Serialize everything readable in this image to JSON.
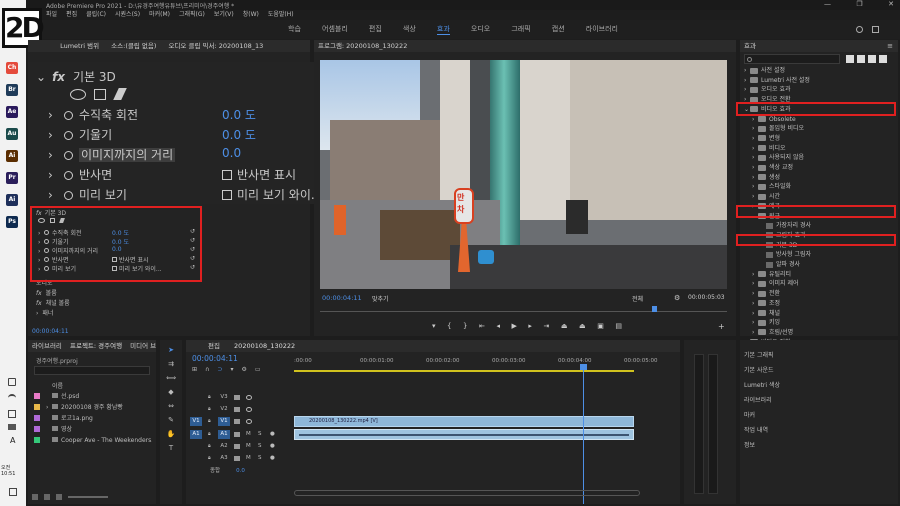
{
  "window": {
    "title": "Adobe Premiere Pro 2021 - D:\\유경주여행유튜브\\프리미어\\경주여행 *",
    "menu": [
      "파일",
      "편집",
      "클립(C)",
      "시퀀스(S)",
      "마커(M)",
      "그래픽(G)",
      "보기(V)",
      "창(W)",
      "도움말(H)"
    ],
    "controls": [
      "—",
      "❐",
      "✕"
    ]
  },
  "logo_text": "2D",
  "workspaces": [
    "학습",
    "어셈블리",
    "편집",
    "색상",
    "효과",
    "오디오",
    "그래픽",
    "캡션",
    "라이브러리"
  ],
  "active_workspace": "효과",
  "taskbar_icons": [
    {
      "label": "Ch",
      "color": "#e44b3c"
    },
    {
      "label": "Br",
      "color": "#1f3b59"
    },
    {
      "label": "Ae",
      "color": "#2a1a5c"
    },
    {
      "label": "Au",
      "color": "#1b4b4b"
    },
    {
      "label": "Ai",
      "color": "#5a2d00"
    },
    {
      "label": "Pr",
      "color": "#2a1e5a"
    },
    {
      "label": "Ai",
      "color": "#1e2f5a"
    },
    {
      "label": "Ps",
      "color": "#0e2a4f"
    }
  ],
  "tray": {
    "lang": "A",
    "time": "오전 10:51"
  },
  "effect_controls": {
    "tabs": [
      "Lumetri 범위",
      "소스:(클립 없음)",
      "오디오 클립 믹서: 20200108_13"
    ],
    "timecode": "00:00:04:11",
    "zoom": {
      "section": "기본 3D",
      "rows": [
        {
          "label": "수직축 회전",
          "value": "0.0 도"
        },
        {
          "label": "기울기",
          "value": "0.0 도"
        },
        {
          "label": "이미지까지의 거리",
          "value": "0.0"
        },
        {
          "label": "반사면",
          "checkbox": "반사면 표시"
        },
        {
          "label": "미리 보기",
          "checkbox": "미리 보기 와이..."
        }
      ]
    },
    "small": {
      "section": "기본 3D",
      "rows": [
        {
          "label": "수직축 회전",
          "value": "0.0 도"
        },
        {
          "label": "기울기",
          "value": "0.0 도"
        },
        {
          "label": "이미지까지의 거리",
          "value": "0.0"
        },
        {
          "label": "반사면",
          "checkbox": "반사면 표시"
        },
        {
          "label": "미리 보기",
          "checkbox": "미리 보기 와이..."
        }
      ]
    },
    "lower": [
      "오디오",
      "볼륨",
      "채널 볼륨",
      "패너"
    ]
  },
  "program": {
    "title": "프로그램: 20200108_130222",
    "timecode": "00:00:04:11",
    "fit": "맞추기",
    "quality": "전체",
    "duration": "00:00:05:03",
    "sign_text": "만차",
    "playhead_frac": 0.82
  },
  "effects_panel": {
    "title": "효과",
    "items": [
      {
        "label": "사전 설정",
        "level": 0,
        "type": "folder"
      },
      {
        "label": "Lumetri 사전 설정",
        "level": 0,
        "type": "folder"
      },
      {
        "label": "오디오 효과",
        "level": 0,
        "type": "folder"
      },
      {
        "label": "오디오 전환",
        "level": 0,
        "type": "folder"
      },
      {
        "label": "비디오 효과",
        "level": 0,
        "type": "folder"
      },
      {
        "label": "Obsolete",
        "level": 1,
        "type": "folder"
      },
      {
        "label": "몰입형 비디오",
        "level": 1,
        "type": "folder"
      },
      {
        "label": "변형",
        "level": 1,
        "type": "folder"
      },
      {
        "label": "비디오",
        "level": 1,
        "type": "folder"
      },
      {
        "label": "사용되지 않음",
        "level": 1,
        "type": "folder"
      },
      {
        "label": "색상 교정",
        "level": 1,
        "type": "folder"
      },
      {
        "label": "생성",
        "level": 1,
        "type": "folder"
      },
      {
        "label": "스타일화",
        "level": 1,
        "type": "folder"
      },
      {
        "label": "시간",
        "level": 1,
        "type": "folder"
      },
      {
        "label": "왜곡",
        "level": 1,
        "type": "folder"
      },
      {
        "label": "원근",
        "level": 1,
        "type": "folder"
      },
      {
        "label": "가장자리 경사",
        "level": 2,
        "type": "fx"
      },
      {
        "label": "그림자 효과",
        "level": 2,
        "type": "fx"
      },
      {
        "label": "기본 3D",
        "level": 2,
        "type": "fx"
      },
      {
        "label": "방사형 그림자",
        "level": 2,
        "type": "fx"
      },
      {
        "label": "알파 경사",
        "level": 2,
        "type": "fx"
      },
      {
        "label": "유틸리티",
        "level": 1,
        "type": "folder"
      },
      {
        "label": "이미지 제어",
        "level": 1,
        "type": "folder"
      },
      {
        "label": "전환",
        "level": 1,
        "type": "folder"
      },
      {
        "label": "조정",
        "level": 1,
        "type": "folder"
      },
      {
        "label": "채널",
        "level": 1,
        "type": "folder"
      },
      {
        "label": "키잉",
        "level": 1,
        "type": "folder"
      },
      {
        "label": "흐림/선명",
        "level": 1,
        "type": "folder"
      },
      {
        "label": "비디오 전환",
        "level": 0,
        "type": "folder"
      }
    ],
    "lower": [
      "기본 그래픽",
      "기본 사운드",
      "Lumetri 색상",
      "라이브러리",
      "마커",
      "작업 내역",
      "정보"
    ]
  },
  "project": {
    "tabs": [
      "라이브러리",
      "프로젝트: 경주여행",
      "미디어 브"
    ],
    "file": "경주여행.prproj",
    "col_name": "이름",
    "items": [
      {
        "name": "선.psd",
        "color": "#e87ac6"
      },
      {
        "name": "20200108 경주 황남빵",
        "color": "#e8b84a"
      },
      {
        "name": "로고1a.png",
        "color": "#b06ad8"
      },
      {
        "name": "영상",
        "color": "#b06ad8"
      },
      {
        "name": "Cooper Ave - The Weekenders.mp3",
        "color": "#35c97a"
      }
    ]
  },
  "timeline": {
    "tabs": [
      "편집",
      "20200108_130222"
    ],
    "timecode": "00:00:04:11",
    "ruler": [
      ":00:00",
      "00:00:01:00",
      "00:00:02:00",
      "00:00:03:00",
      "00:00:04:00",
      "00:00:05:00"
    ],
    "tracks": [
      {
        "name": "V3",
        "kind": "v"
      },
      {
        "name": "V2",
        "kind": "v"
      },
      {
        "name": "V1",
        "kind": "v",
        "src": "V1"
      },
      {
        "name": "A1",
        "kind": "a",
        "src": "A1"
      },
      {
        "name": "A2",
        "kind": "a"
      },
      {
        "name": "A3",
        "kind": "a"
      }
    ],
    "master": {
      "label": "종합",
      "value": "0.0"
    },
    "clip_label": "20200108_130222.mp4 [V]",
    "playhead_frac": 0.85
  }
}
